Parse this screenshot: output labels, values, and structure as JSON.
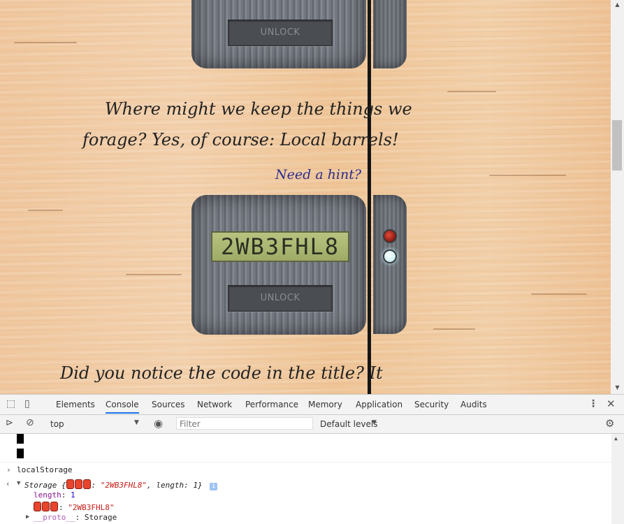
{
  "page": {
    "safe_top": {
      "unlock_label": "UNLOCK"
    },
    "riddle": {
      "line1": "Where might we keep the things we",
      "line2": "forage? Yes, of course: Local barrels!"
    },
    "hint_label": "Need a hint?",
    "safe_main": {
      "display_code": "2WB3FHL8",
      "unlock_label": "UNLOCK"
    },
    "bottom_text": "Did you notice the code in the title? It"
  },
  "devtools": {
    "tabs": [
      "Elements",
      "Console",
      "Sources",
      "Network",
      "Performance",
      "Memory",
      "Application",
      "Security",
      "Audits"
    ],
    "active_tab": "Console",
    "context": "top",
    "filter_placeholder": "Filter",
    "levels": "Default levels",
    "console": {
      "command": "localStorage",
      "storage_prefix": "Storage {",
      "storage_value": "\"2WB3FHL8\"",
      "storage_length": ", length: 1}",
      "info_badge": "i",
      "length_key": "length",
      "length_val": "1",
      "entry_value": "\"2WB3FHL8\"",
      "proto_key": "__proto__",
      "proto_val": "Storage"
    }
  }
}
